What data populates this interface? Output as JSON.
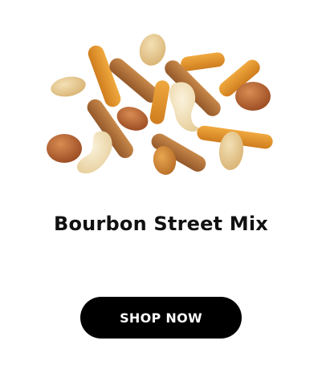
{
  "product": {
    "image_icon": "snack-mix-image",
    "title": "Bourbon Street Mix"
  },
  "cta": {
    "label": "SHOP NOW"
  },
  "colors": {
    "background": "#ffffff",
    "title_text": "#111111",
    "button_bg": "#000000",
    "button_text": "#ffffff"
  }
}
